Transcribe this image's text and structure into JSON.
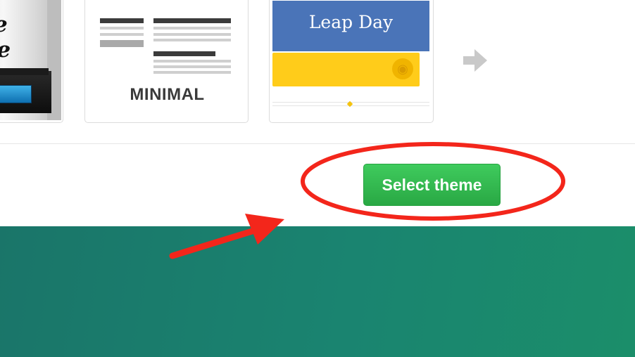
{
  "themes": {
    "time_machine": {
      "title_line1": "e",
      "title_line2": "ine"
    },
    "minimal": {
      "label": "MINIMAL"
    },
    "leap_day": {
      "title": "Leap Day"
    }
  },
  "next_icon": "arrow-right-icon",
  "actions": {
    "select_theme_label": "Select theme"
  },
  "colors": {
    "button_green": "#2ea84a",
    "footer_teal": "#1a8470",
    "annotation_red": "#f3261b",
    "leap_blue": "#4a74b8",
    "leap_yellow": "#ffcc1a"
  },
  "annotations": {
    "highlight": "red-ellipse-around-select-theme",
    "pointer": "red-arrow"
  }
}
